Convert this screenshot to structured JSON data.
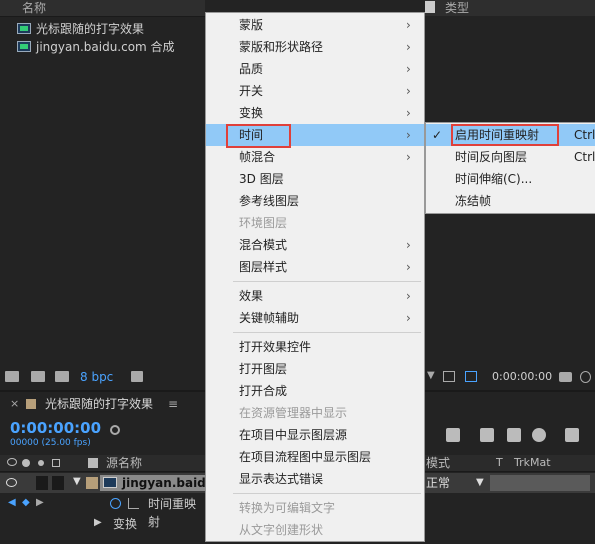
{
  "project": {
    "col_name": "名称",
    "col_type": "类型",
    "rows": [
      {
        "label": "光标跟随的打字效果"
      },
      {
        "label": "jingyan.baidu.com 合成"
      }
    ],
    "bpc": "8 bpc",
    "viewer_timecode": "0:00:00:00"
  },
  "timeline": {
    "close": "×",
    "tab_name": "光标跟随的打字效果",
    "menu": "≡",
    "timecode": "0:00:00:00",
    "fps": "00000 (25.00 fps)",
    "col_source": "源名称",
    "col_mode": "模式",
    "col_t": "T",
    "col_trkmat": "TrkMat",
    "layer_name": "jingyan.baidu.",
    "layer_mode": "正常",
    "sub_prop": "时间重映射",
    "sub_transform": "变换"
  },
  "menu": {
    "items": [
      {
        "label": "蒙版",
        "arrow": "›"
      },
      {
        "label": "蒙版和形状路径",
        "arrow": "›"
      },
      {
        "label": "品质",
        "arrow": "›"
      },
      {
        "label": "开关",
        "arrow": "›"
      },
      {
        "label": "变换",
        "arrow": "›"
      },
      {
        "label": "时间",
        "arrow": "›"
      },
      {
        "label": "帧混合",
        "arrow": "›"
      },
      {
        "label": "3D 图层"
      },
      {
        "label": "参考线图层"
      },
      {
        "label": "环境图层"
      },
      {
        "label": "混合模式",
        "arrow": "›"
      },
      {
        "label": "图层样式",
        "arrow": "›"
      },
      {
        "label": "效果",
        "arrow": "›"
      },
      {
        "label": "关键帧辅助",
        "arrow": "›"
      },
      {
        "label": "打开效果控件"
      },
      {
        "label": "打开图层"
      },
      {
        "label": "打开合成"
      },
      {
        "label": "在资源管理器中显示"
      },
      {
        "label": "在项目中显示图层源"
      },
      {
        "label": "在项目流程图中显示图层"
      },
      {
        "label": "显示表达式错误"
      },
      {
        "label": "转换为可编辑文字"
      },
      {
        "label": "从文字创建形状"
      }
    ]
  },
  "submenu": {
    "items": [
      {
        "label": "启用时间重映射",
        "shortcut": "Ctrl",
        "check": "✓"
      },
      {
        "label": "时间反向图层",
        "shortcut": "Ctrl"
      },
      {
        "label": "时间伸缩(C)..."
      },
      {
        "label": "冻结帧"
      }
    ]
  },
  "colors": {
    "highlight": "#91c9f7",
    "accent_blue": "#4aa3ff",
    "annotation_red": "#e0403a"
  }
}
